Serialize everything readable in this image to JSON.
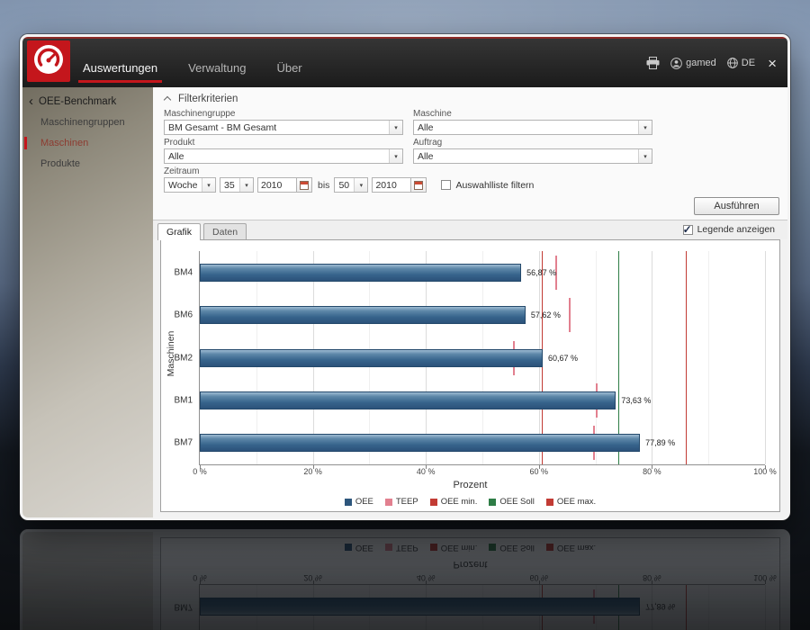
{
  "header": {
    "tabs": [
      {
        "label": "Auswertungen"
      },
      {
        "label": "Verwaltung"
      },
      {
        "label": "Über"
      }
    ],
    "user": "gamed",
    "language": "DE",
    "close_label": "×"
  },
  "sidebar": {
    "back_chevron": "‹",
    "title": "OEE-Benchmark",
    "items": [
      {
        "label": "Maschinengruppen"
      },
      {
        "label": "Maschinen"
      },
      {
        "label": "Produkte"
      }
    ]
  },
  "filter": {
    "title": "Filterkriterien",
    "maschinengruppe_label": "Maschinengruppe",
    "maschinengruppe_value": "BM Gesamt - BM Gesamt",
    "maschine_label": "Maschine",
    "maschine_value": "Alle",
    "produkt_label": "Produkt",
    "produkt_value": "Alle",
    "auftrag_label": "Auftrag",
    "auftrag_value": "Alle",
    "zeitraum_label": "Zeitraum",
    "period_type": "Woche",
    "from_week": "35",
    "from_year": "2010",
    "bis_label": "bis",
    "to_week": "50",
    "to_year": "2010",
    "filter_checkbox_label": "Auswahlliste filtern",
    "filter_checkbox_checked": false,
    "run_button": "Ausführen"
  },
  "view_tabs": {
    "grafik": "Grafik",
    "daten": "Daten"
  },
  "legend_toggle": {
    "label": "Legende anzeigen",
    "checked": true
  },
  "chart_data": {
    "type": "bar",
    "orientation": "horizontal",
    "xlabel": "Prozent",
    "ylabel": "Maschinen",
    "xlim": [
      0,
      100
    ],
    "grid": true,
    "categories": [
      "BM4",
      "BM6",
      "BM2",
      "BM1",
      "BM7"
    ],
    "values": [
      56.87,
      57.62,
      60.67,
      73.63,
      77.89
    ],
    "value_labels": [
      "56,87 %",
      "57,62 %",
      "60,67 %",
      "73,63 %",
      "77,89 %"
    ],
    "x_ticks": [
      {
        "value": 0,
        "label": "0 %"
      },
      {
        "value": 20,
        "label": "20 %"
      },
      {
        "value": 40,
        "label": "40 %"
      },
      {
        "value": 60,
        "label": "60 %"
      },
      {
        "value": 80,
        "label": "80 %"
      },
      {
        "value": 100,
        "label": "100 %"
      }
    ],
    "reference_lines": [
      {
        "label": "OEE min.",
        "value": 60.5,
        "color": "#c23b34"
      },
      {
        "label": "OEE Soll",
        "value": 74.0,
        "color": "#2e7d46"
      },
      {
        "label": "OEE max.",
        "value": 86.0,
        "color": "#c23b34"
      }
    ],
    "teep_markers": {
      "label": "TEEP",
      "color": "#e2808f",
      "values": [
        63.0,
        65.5,
        55.5,
        70.3,
        69.8
      ]
    },
    "legend": [
      {
        "label": "OEE",
        "color": "#2d567c"
      },
      {
        "label": "TEEP",
        "color": "#e2808f"
      },
      {
        "label": "OEE min.",
        "color": "#c23b34"
      },
      {
        "label": "OEE Soll",
        "color": "#2e7d46"
      },
      {
        "label": "OEE max.",
        "color": "#c23b34"
      }
    ]
  }
}
